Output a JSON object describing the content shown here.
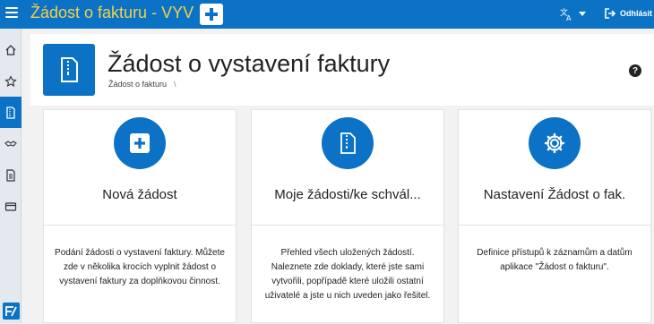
{
  "topbar": {
    "app_title": "Žádost o fakturu - VYV",
    "logout_label": "Odhlásit",
    "icons": {
      "menu": "hamburger-icon",
      "add": "plus-icon",
      "language": "translate-icon",
      "logout": "logout-icon"
    }
  },
  "sidebar": {
    "items": [
      {
        "name": "home",
        "icon": "home-icon"
      },
      {
        "name": "favorites",
        "icon": "star-icon"
      },
      {
        "name": "requests",
        "icon": "document-zip-icon",
        "active": true
      },
      {
        "name": "handshake",
        "icon": "handshake-icon"
      },
      {
        "name": "documents",
        "icon": "document-icon"
      },
      {
        "name": "card",
        "icon": "card-icon"
      }
    ],
    "logo": "app-logo-icon"
  },
  "header": {
    "title": "Žádost o vystavení faktury",
    "breadcrumb": "Žádost o fakturu",
    "breadcrumb_sep": "\\",
    "help_label": "?"
  },
  "cards": [
    {
      "title": "Nová žádost",
      "icon": "plus-square-icon",
      "description": "Podání žádosti o vystavení faktury. Můžete zde v několika krocích vyplnit žádost o vystavení faktury za doplňkovou činnost."
    },
    {
      "title": "Moje žádosti/ke schvál...",
      "icon": "document-zip-icon",
      "description": "Přehled všech uložených žádostí. Naleznete zde doklady, které jste sami vytvořili, popřípadě které uložili ostatní uživatelé a jste u nich uveden jako řešitel."
    },
    {
      "title": "Nastavení Žádost o fak.",
      "icon": "gear-icon",
      "description": "Definice přístupů k záznamům a datům aplikace \"Žádost o fakturu\"."
    }
  ],
  "colors": {
    "accent": "#0b72c6",
    "title_yellow": "#f0d24a",
    "background": "#f2f2f2"
  }
}
